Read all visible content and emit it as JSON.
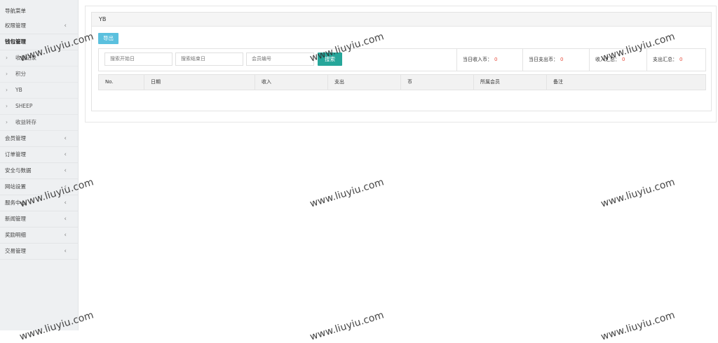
{
  "sidebar": {
    "title": "导航菜单",
    "items": [
      {
        "label": "权限管理",
        "chevron": "‹"
      },
      {
        "label": "钱包管理",
        "chevron": ""
      },
      {
        "label": "收益记录",
        "sub": true
      },
      {
        "label": "积分",
        "sub": true
      },
      {
        "label": "YB",
        "sub": true
      },
      {
        "label": "SHEEP",
        "sub": true
      },
      {
        "label": "收益转存",
        "sub": true
      },
      {
        "label": "会员管理",
        "chevron": "‹"
      },
      {
        "label": "订单管理",
        "chevron": "‹"
      },
      {
        "label": "安全与数据",
        "chevron": "‹"
      },
      {
        "label": "网站设置",
        "chevron": "‹"
      },
      {
        "label": "服务中心",
        "chevron": "‹"
      },
      {
        "label": "新闻管理",
        "chevron": "‹"
      },
      {
        "label": "奖励明细",
        "chevron": "‹"
      },
      {
        "label": "交易管理",
        "chevron": "‹"
      }
    ]
  },
  "panel": {
    "title": "YB",
    "export_label": "导出",
    "search": {
      "start_placeholder": "搜索开始日",
      "end_placeholder": "搜索结束日",
      "member_placeholder": "会员编号",
      "button_label": "搜索"
    },
    "stats": [
      {
        "label": "当日收入币：",
        "value": "0"
      },
      {
        "label": "当日支出币：",
        "value": "0"
      },
      {
        "label": "收入汇总：",
        "value": "0"
      },
      {
        "label": "支出汇总：",
        "value": "0"
      }
    ],
    "columns": [
      "No.",
      "日期",
      "收入",
      "支出",
      "币",
      "所属会员",
      "备注"
    ]
  },
  "watermark": "www.liuyiu.com",
  "colors": {
    "export_button": "#5bc0de",
    "search_button": "#26a69a",
    "stat_value": "#e64c3c",
    "sidebar_bg": "#eef0f2"
  }
}
